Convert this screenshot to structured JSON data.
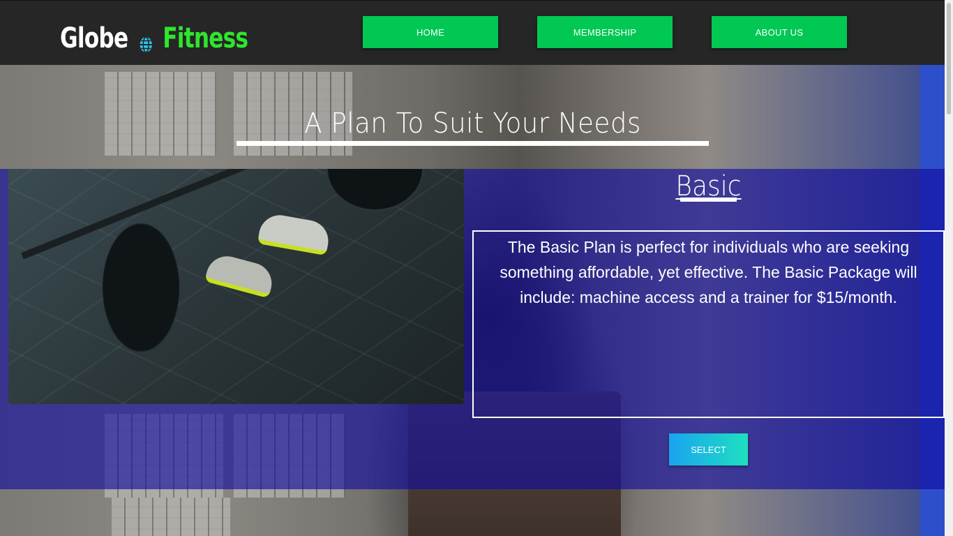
{
  "header": {
    "logo_part1": "Globe",
    "logo_part2": "Fitness",
    "logo_icon": "globe-icon",
    "nav": [
      {
        "label": "HOME"
      },
      {
        "label": "MEMBERSHIP"
      },
      {
        "label": "ABOUT US"
      }
    ]
  },
  "hero": {
    "title": "A Plan To Suit Your Needs"
  },
  "plan": {
    "name": "Basic",
    "description": "The Basic Plan is perfect for individuals who are seeking something affordable, yet effective. The Basic Package will include: machine access and a trainer for $15/month.",
    "select_label": "SELECT"
  },
  "colors": {
    "header_bg": "#262626",
    "nav_button": "#00c853",
    "logo_accent": "#2ee62e",
    "plan_band": "#0f0aa0",
    "select_gradient_start": "#1aa3f0",
    "select_gradient_end": "#1ee0c0"
  }
}
